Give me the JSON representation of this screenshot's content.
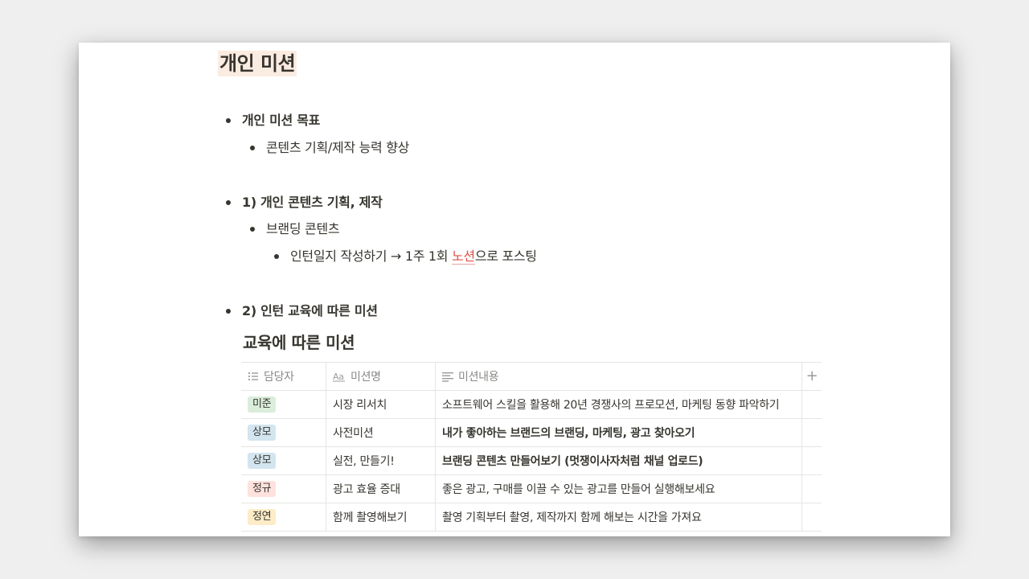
{
  "page": {
    "title": "개인 미션"
  },
  "bullets": [
    {
      "text": "개인 미션 목표"
    },
    {
      "text": "콘텐츠 기획/제작 능력 향상"
    },
    {
      "text": "1) 개인 콘텐츠 기획, 제작"
    },
    {
      "text": "브랜딩 콘텐츠"
    },
    {
      "text_before": "인턴일지 작성하기 → 1주 1회 ",
      "link": "노션",
      "text_after": "으로 포스팅"
    },
    {
      "text": "2) 인턴 교육에 따른 미션"
    }
  ],
  "database": {
    "title": "교육에 따른 미션",
    "columns": [
      {
        "label": "담당자",
        "icon": "list-icon"
      },
      {
        "label": "미션명",
        "icon": "text-aa-icon"
      },
      {
        "label": "미션내용",
        "icon": "paragraph-icon"
      }
    ],
    "add_column": "+",
    "rows": [
      {
        "assignee": "미준",
        "tag_color": "#dbeddb",
        "name": "시장 리서치",
        "content": "소프트웨어 스킬을 활용해 20년 경쟁사의 프로모션, 마케팅 동향 파악하기",
        "bold": false
      },
      {
        "assignee": "상모",
        "tag_color": "#d3e5ef",
        "name": "사전미션",
        "content": "내가 좋아하는 브랜드의 브랜딩, 마케팅, 광고 찾아오기",
        "bold": true
      },
      {
        "assignee": "상모",
        "tag_color": "#d3e5ef",
        "name": "실전, 만들기!",
        "content": "브랜딩 콘텐츠 만들어보기 (멋쟁이사자처럼 채널 업로드)",
        "bold": true
      },
      {
        "assignee": "정규",
        "tag_color": "#ffe2dd",
        "name": "광고 효율 증대",
        "content": "좋은 광고, 구매를 이끌 수 있는 광고를 만들어 실행해보세요",
        "bold": false
      },
      {
        "assignee": "정연",
        "tag_color": "#fdecc8",
        "name": "함께 촬영해보기",
        "content": "촬영 기획부터 촬영, 제작까지 함께 해보는 시간을 가져요",
        "bold": false
      }
    ]
  }
}
